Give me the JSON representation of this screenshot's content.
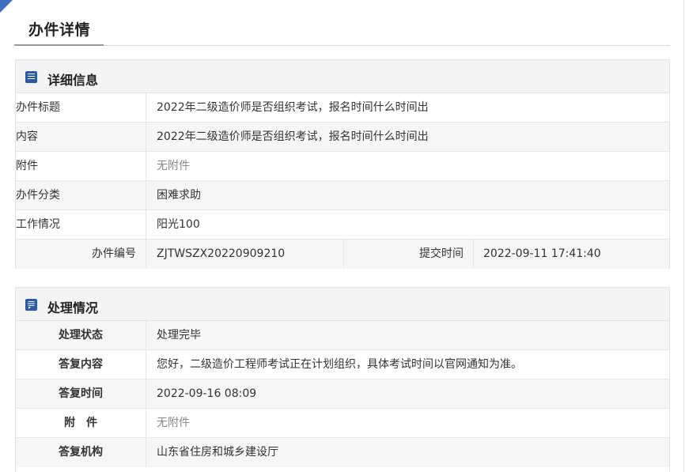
{
  "page": {
    "title": "办件详情"
  },
  "detail": {
    "heading": "详细信息",
    "rows": [
      {
        "label": "办件标题",
        "value": "2022年二级造价师是否组织考试，报名时间什么时间出"
      },
      {
        "label": "内容",
        "value": "2022年二级造价师是否组织考试，报名时间什么时间出"
      },
      {
        "label": "附件",
        "value": "无附件"
      },
      {
        "label": "办件分类",
        "value": "困难求助"
      },
      {
        "label": "工作情况",
        "value": "阳光100"
      }
    ],
    "meta": {
      "number_label": "办件编号",
      "number_value": "ZJTWSZX20220909210",
      "time_label": "提交时间",
      "time_value": "2022-09-11 17:41:40"
    }
  },
  "process": {
    "heading": "处理情况",
    "rows": [
      {
        "label": "处理状态",
        "value": "处理完毕"
      },
      {
        "label": "答复内容",
        "value": "您好，二级造价工程师考试正在计划组织，具体考试时间以官网通知为准。"
      },
      {
        "label": "答复时间",
        "value": "2022-09-16 08:09"
      },
      {
        "label": "附　件",
        "value": "无附件"
      },
      {
        "label": "答复机构",
        "value": "山东省住房和城乡建设厅"
      }
    ]
  },
  "icons": {
    "detail": "list-icon",
    "process": "chat-icon"
  },
  "colors": {
    "accent": "#2d5aa8",
    "header_bg": "#f4f4f4",
    "alt_row": "#f6f6f6"
  }
}
